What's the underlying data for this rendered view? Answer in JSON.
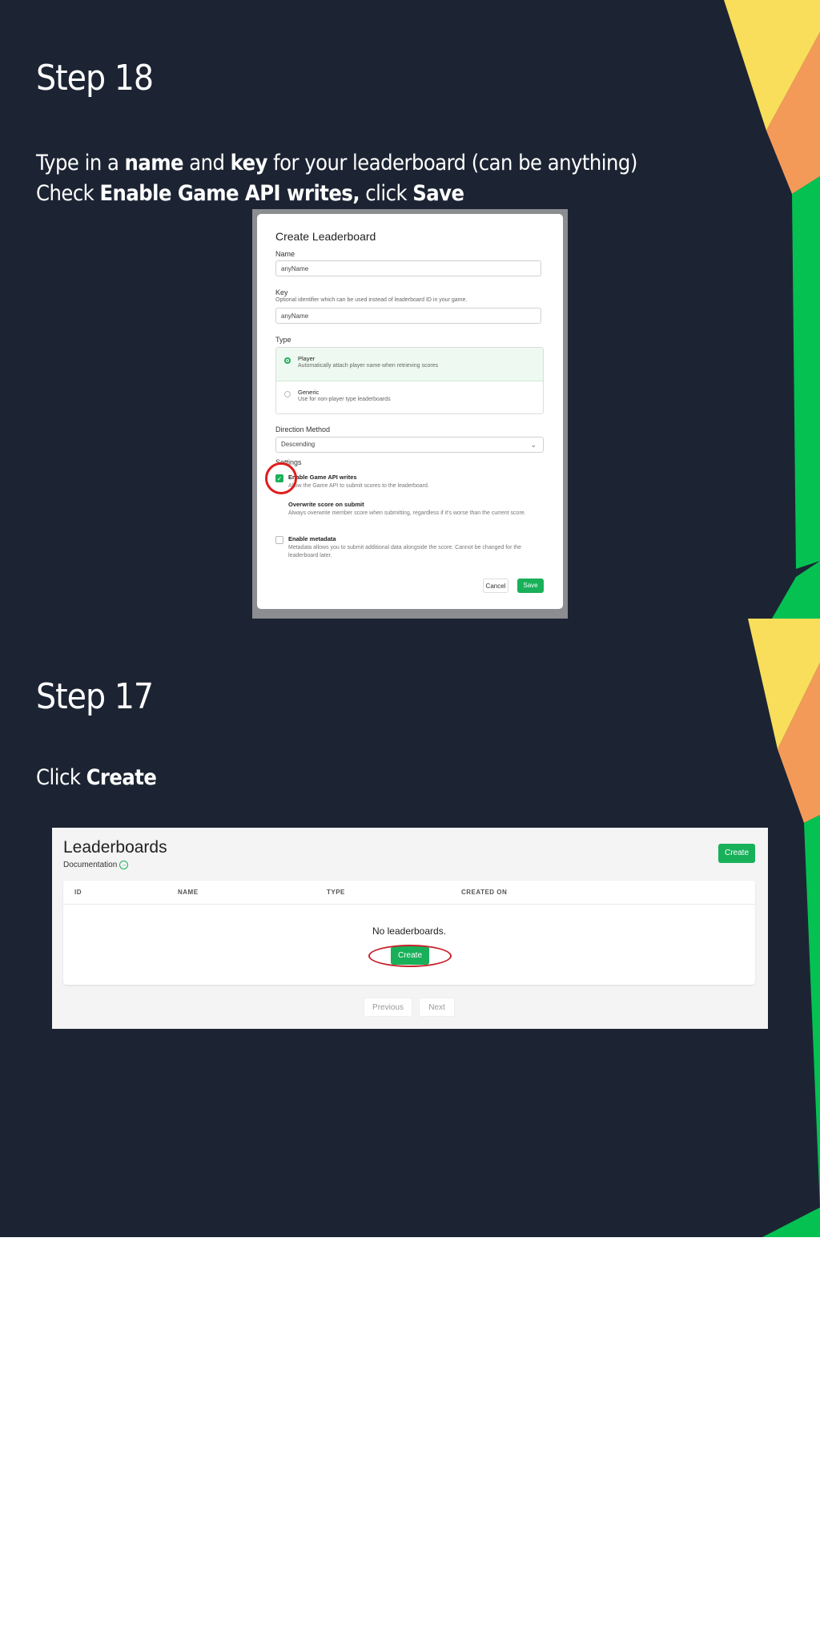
{
  "colors": {
    "slide_bg": "#1c2433",
    "accent_yellow": "#f8de5a",
    "accent_orange": "#f49a59",
    "accent_green": "#04c152",
    "brand_green": "#19b05a",
    "annotation_red": "#e01c1c"
  },
  "step18": {
    "title": "Step 18",
    "line1": {
      "p1": "Type in a ",
      "b1": "name",
      "p2": " and ",
      "b2": "key",
      "p3": " for your leaderboard (can be anything)"
    },
    "line2": {
      "p1": "Check ",
      "b1": "Enable Game API writes,",
      "p2": " click ",
      "b2": "Save"
    },
    "modal": {
      "title": "Create Leaderboard",
      "name_label": "Name",
      "name_value": "anyName",
      "key_label": "Key",
      "key_help": "Optional identifier which can be used instead of leaderboard ID in your game.",
      "key_value": "anyName",
      "type_label": "Type",
      "type_player_title": "Player",
      "type_player_sub": "Automatically attach player name when retrieving scores",
      "type_generic_title": "Generic",
      "type_generic_sub": "Use for non-player type leaderboards",
      "direction_label": "Direction Method",
      "direction_value": "Descending",
      "settings_label": "Settings",
      "opt1_title": "Enable Game API writes",
      "opt1_sub": "Allow the Game API to submit scores to the leaderboard.",
      "opt2_title": "Overwrite score on submit",
      "opt2_sub": "Always overwrite member score when submitting, regardless if it's worse than the current score.",
      "opt3_title": "Enable metadata",
      "opt3_sub": "Metadata allows you to submit additional data alongside the score. Cannot be changed for the leaderboard later.",
      "cancel": "Cancel",
      "save": "Save"
    }
  },
  "step17": {
    "title": "Step 17",
    "desc": {
      "p1": "Click ",
      "b1": "Create"
    },
    "leaderboards": {
      "title": "Leaderboards",
      "documentation": "Documentation",
      "create_top": "Create",
      "columns": [
        "ID",
        "NAME",
        "TYPE",
        "CREATED ON"
      ],
      "empty": "No leaderboards.",
      "create_mid": "Create",
      "previous": "Previous",
      "next": "Next"
    }
  }
}
